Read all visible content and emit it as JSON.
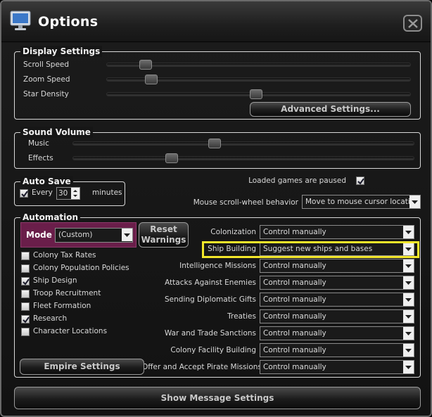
{
  "window": {
    "title": "Options",
    "app_icon": "monitor-icon",
    "close_icon": "close-icon"
  },
  "display": {
    "legend": "Display Settings",
    "scroll_speed": {
      "label": "Scroll Speed",
      "value": 0.11
    },
    "zoom_speed": {
      "label": "Zoom Speed",
      "value": 0.13
    },
    "star_density": {
      "label": "Star Density",
      "value": 0.49
    },
    "advanced_button": "Advanced Settings..."
  },
  "sound": {
    "legend": "Sound Volume",
    "music": {
      "label": "Music",
      "value": 0.41
    },
    "effects": {
      "label": "Effects",
      "value": 0.28
    }
  },
  "autosave": {
    "legend": "Auto Save",
    "every_label": "Every",
    "checked": true,
    "minutes_value": "30",
    "minutes_label": "minutes"
  },
  "misc": {
    "loaded_paused_label": "Loaded games are paused",
    "loaded_paused_checked": true,
    "mouse_wheel_label": "Mouse scroll-wheel behavior",
    "mouse_wheel_value": "Move to mouse cursor location"
  },
  "automation": {
    "legend": "Automation",
    "mode_label": "Mode",
    "mode_value": "(Custom)",
    "reset_line1": "Reset",
    "reset_line2": "Warnings",
    "checkboxes": [
      {
        "label": "Colony Tax Rates",
        "checked": false
      },
      {
        "label": "Colony Population Policies",
        "checked": false
      },
      {
        "label": "Ship Design",
        "checked": true
      },
      {
        "label": "Troop Recruitment",
        "checked": false
      },
      {
        "label": "Fleet Formation",
        "checked": false
      },
      {
        "label": "Research",
        "checked": true
      },
      {
        "label": "Character Locations",
        "checked": false
      }
    ],
    "settings": [
      {
        "label": "Colonization",
        "value": "Control manually"
      },
      {
        "label": "Ship Building",
        "value": "Suggest new ships and bases"
      },
      {
        "label": "Intelligence Missions",
        "value": "Control manually"
      },
      {
        "label": "Attacks Against Enemies",
        "value": "Control manually"
      },
      {
        "label": "Sending Diplomatic Gifts",
        "value": "Control manually"
      },
      {
        "label": "Treaties",
        "value": "Control manually"
      },
      {
        "label": "War and Trade Sanctions",
        "value": "Control manually"
      },
      {
        "label": "Colony Facility Building",
        "value": "Control manually"
      },
      {
        "label": "Offer and Accept Pirate Missions",
        "value": "Control manually"
      }
    ],
    "empire_button": "Empire Settings"
  },
  "footer": {
    "message_button": "Show Message Settings"
  },
  "colors": {
    "mode_bg": "#6a1e4a",
    "highlight": "#f2e62a"
  }
}
